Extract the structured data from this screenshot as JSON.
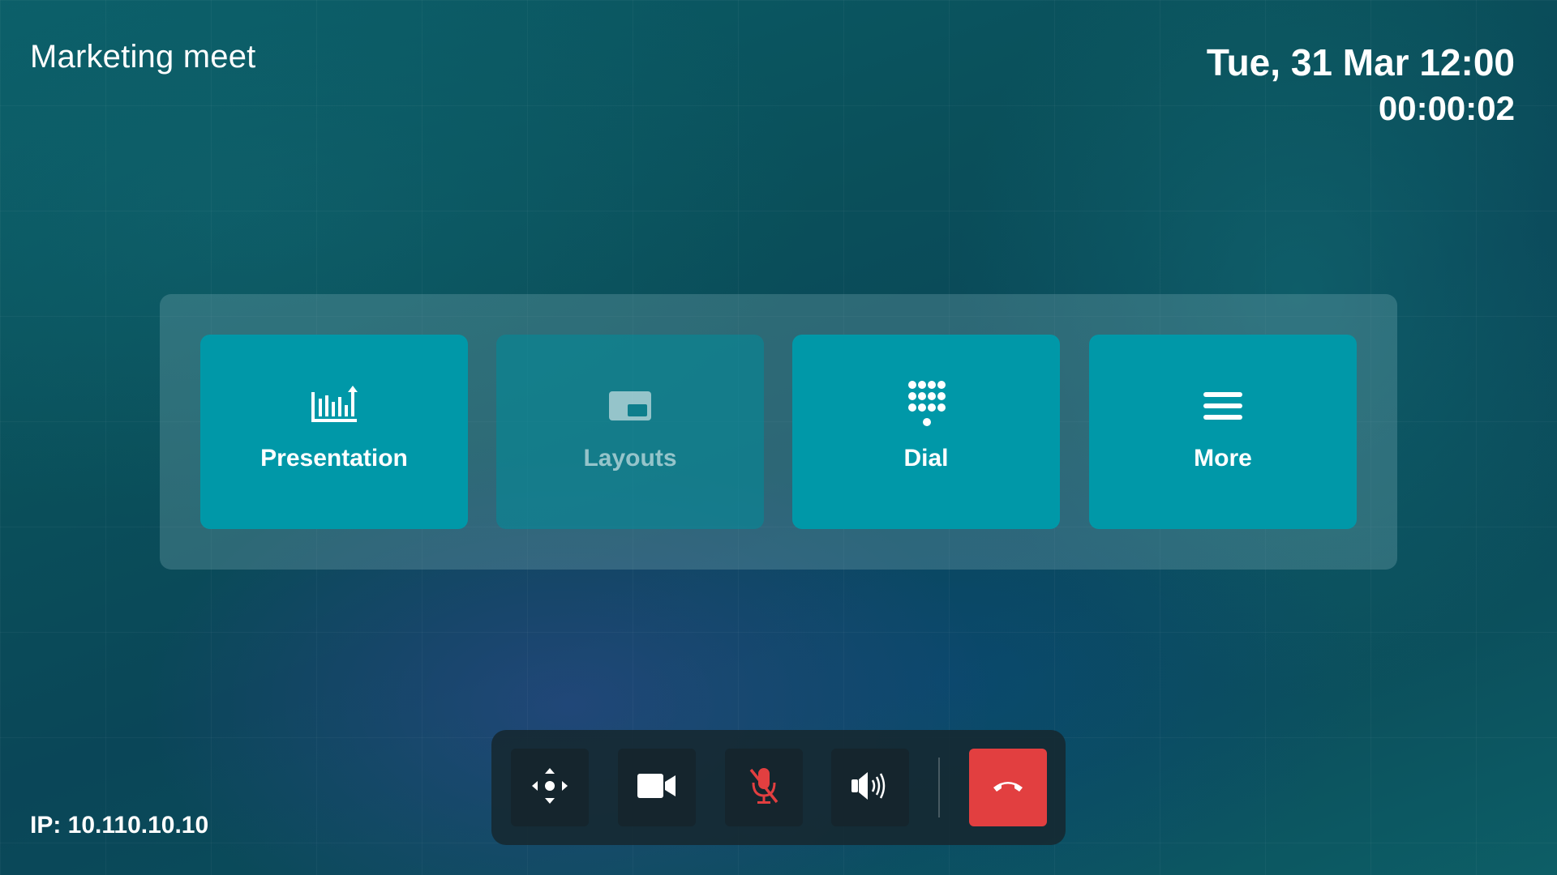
{
  "header": {
    "meeting_title": "Marketing meet",
    "datetime": "Tue, 31 Mar 12:00",
    "call_duration": "00:00:02"
  },
  "footer": {
    "ip_address": "IP: 10.110.10.10"
  },
  "menu": {
    "tiles": [
      {
        "label": "Presentation",
        "icon": "presentation-chart-icon",
        "enabled": true
      },
      {
        "label": "Layouts",
        "icon": "layouts-icon",
        "enabled": false
      },
      {
        "label": "Dial",
        "icon": "dialpad-icon",
        "enabled": true
      },
      {
        "label": "More",
        "icon": "menu-hamburger-icon",
        "enabled": true
      }
    ]
  },
  "toolbar": {
    "buttons": [
      {
        "icon": "camera-move-icon",
        "state": "default"
      },
      {
        "icon": "video-camera-icon",
        "state": "on"
      },
      {
        "icon": "microphone-muted-icon",
        "state": "muted"
      },
      {
        "icon": "speaker-volume-icon",
        "state": "default"
      },
      {
        "icon": "hang-up-icon",
        "state": "end-call"
      }
    ]
  },
  "colors": {
    "tile_active": "#0098a8",
    "tile_disabled": "#0e7e8c",
    "hangup": "#e23f40",
    "mic_muted": "#e23f40",
    "toolbar_bg": "#162830"
  }
}
